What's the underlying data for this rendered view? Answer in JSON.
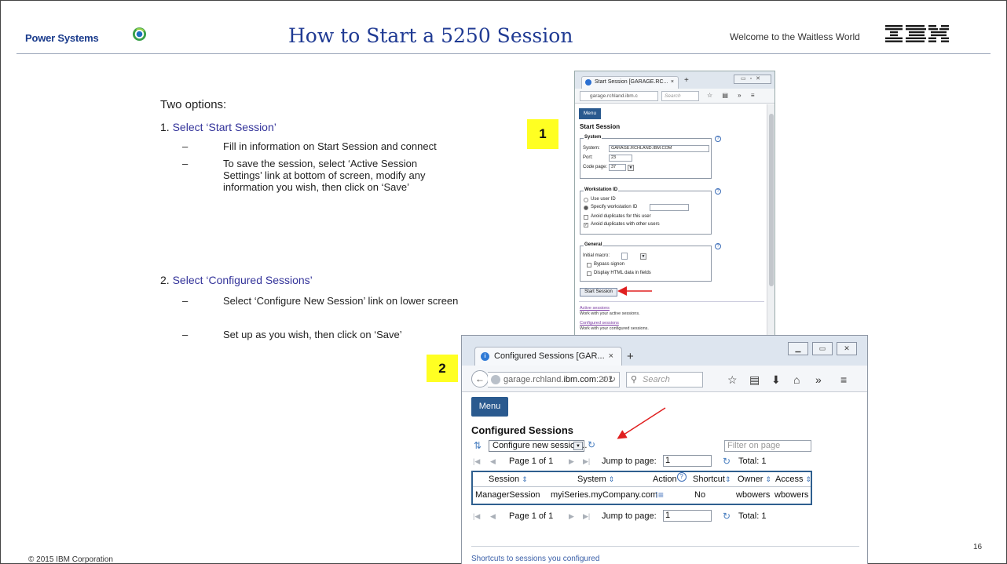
{
  "header": {
    "brand": "Power Systems",
    "title": "How to Start a 5250 Session",
    "tagline": "Welcome to the Waitless World",
    "ibm_logo": "IBM"
  },
  "content": {
    "intro": "Two options:",
    "option1": {
      "num": "1.",
      "title": "Select ‘Start Session’",
      "bullets": [
        "Fill in information on Start Session and connect",
        "To save the session, select ‘Active Session Settings’ link at bottom of screen, modify any information you wish, then click on ‘Save’"
      ]
    },
    "option2": {
      "num": "2.",
      "title": "Select ‘Configured Sessions’",
      "bullets": [
        "Select ‘Configure New Session’ link on lower screen",
        "Set up as you wish, then click on ‘Save’"
      ]
    },
    "bullet_char": "–"
  },
  "badges": {
    "one": "1",
    "two": "2"
  },
  "browser1": {
    "tab_title": "Start Session [GARAGE.RC...",
    "tab_close": "×",
    "new_tab": "+",
    "url": "garage.rchland.ibm.c",
    "search_placeholder": "Search",
    "menu": "Menu",
    "heading": "Start Session",
    "system": {
      "legend": "System",
      "system_label": "System:",
      "system_value": "GARAGE.RCHLAND.IBM.COM",
      "port_label": "Port:",
      "port_value": "23",
      "codepage_label": "Code page:",
      "codepage_value": "37"
    },
    "workstation": {
      "legend": "Workstation ID",
      "use_user_id": "Use user ID",
      "specify_id": "Specify workstation ID",
      "avoid_user": "Avoid duplicates for this user",
      "avoid_other": "Avoid duplicates with other users"
    },
    "general": {
      "legend": "General",
      "initial_macro": "Initial macro:",
      "bypass_signon": "Bypass signon",
      "display_html": "Display HTML data in fields"
    },
    "help": "?",
    "start_button": "Start Session",
    "active_link": "Active sessions",
    "active_desc": "Work with your active sessions.",
    "configured_link": "Configured sessions",
    "configured_desc": "Work with your configured sessions."
  },
  "browser2": {
    "tab_title": "Configured Sessions [GAR...",
    "tab_close": "×",
    "new_tab": "+",
    "url_prefix": "garage.rchland.",
    "url_domain": "ibm.com",
    "url_suffix": ":201",
    "search_placeholder": "Search",
    "menu": "Menu",
    "heading": "Configured Sessions",
    "configure_select": "Configure new session...",
    "filter_placeholder": "Filter on page",
    "pager": {
      "page_label": "Page 1 of 1",
      "jump_label": "Jump to page:",
      "jump_value": "1",
      "total": "Total: 1"
    },
    "table": {
      "headers": [
        "Session",
        "System",
        "Action",
        "Shortcut",
        "Owner",
        "Access"
      ],
      "rows": [
        [
          "ManagerSession",
          "myiSeries.myCompany.com",
          "",
          "No",
          "wbowers",
          "wbowers"
        ]
      ]
    },
    "bottom_link": "Shortcuts to sessions you configured"
  },
  "footer": {
    "copyright": "© 2015 IBM Corporation",
    "page_number": "16"
  },
  "colors": {
    "title_blue": "#1f3a93",
    "option_blue": "#33339a",
    "menu_blue": "#2a5a8f",
    "badge_yellow": "#ffff22",
    "arrow_red": "#e02020"
  }
}
